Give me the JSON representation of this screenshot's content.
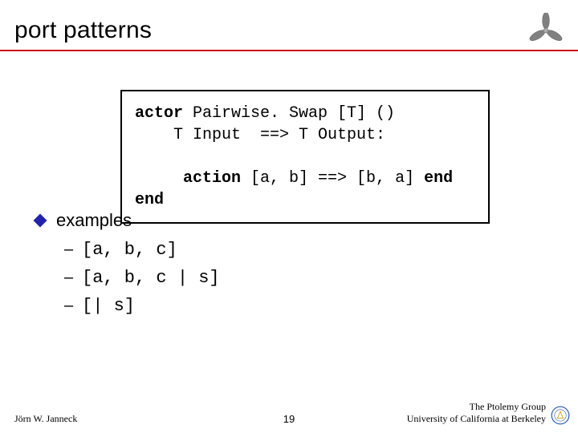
{
  "title": "port patterns",
  "code": {
    "l1_kw1": "actor",
    "l1_rest": " Pairwise. Swap [T] ()",
    "l2": "    T Input  ==> T Output:",
    "blank": "",
    "l3_indent": "     ",
    "l3_kw": "action",
    "l3_mid": " [a, b] ==> [b, a] ",
    "l3_kw2": "end",
    "l4_kw": "end"
  },
  "bullet": "examples",
  "subs": [
    "[a, b, c]",
    "[a, b, c | s]",
    "[| s]"
  ],
  "footer": {
    "left": "Jörn W. Janneck",
    "page": "19",
    "right1": "The Ptolemy Group",
    "right2": "University of California at Berkeley"
  }
}
